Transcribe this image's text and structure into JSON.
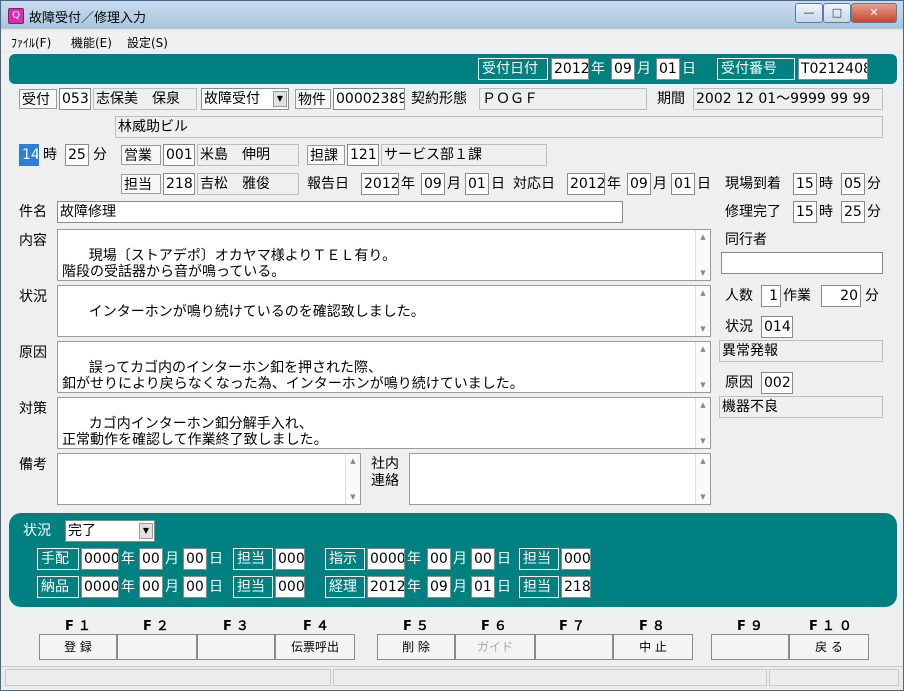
{
  "window": {
    "title": "故障受付／修理入力",
    "app_icon": "Q",
    "minimize": "—",
    "maximize": "□",
    "close": "✕"
  },
  "menu": [
    "ﾌｧｲﾙ(F)",
    "機能(E)",
    "設定(S)"
  ],
  "header": {
    "date_label": "受付日付",
    "year": "2012",
    "year_unit": "年",
    "month": "09",
    "month_unit": "月",
    "day": "01",
    "day_unit": "日",
    "number_label": "受付番号",
    "number": "T0212408"
  },
  "reception": {
    "label": "受付",
    "code": "053",
    "name": "志保美　保泉",
    "type": "故障受付",
    "property_label": "物件",
    "property_code": "00002389",
    "contract_label": "契約形態",
    "contract": "ＰＯＧＦ",
    "period_label": "期間",
    "period": "2002 12 01～9999 99 99",
    "building": "林威助ビル"
  },
  "time": {
    "hour": "14",
    "hour_unit": "時",
    "minute": "25",
    "minute_unit": "分"
  },
  "sales": {
    "label": "営業",
    "code": "001",
    "name": "米島　伸明",
    "dept_label": "担課",
    "dept_code": "121",
    "dept_name": "サービス部１課"
  },
  "staff": {
    "label": "担当",
    "code": "218",
    "name": "吉松　雅俊",
    "report_label": "報告日",
    "report_year": "2012",
    "report_month": "09",
    "report_day": "01",
    "response_label": "対応日",
    "response_year": "2012",
    "response_month": "09",
    "response_day": "01",
    "arrival_label": "現場到着",
    "arrival_hour": "15",
    "arrival_minute": "05"
  },
  "units": {
    "year": "年",
    "month": "月",
    "day": "日",
    "hour": "時",
    "minute": "分"
  },
  "subject": {
    "label": "件名",
    "value": "故障修理",
    "repair_done_label": "修理完了",
    "repair_hour": "15",
    "repair_minute": "25"
  },
  "details": {
    "content_label": "内容",
    "content": "現場〔ストアデポ〕オカヤマ様よりＴＥＬ有り。\n階段の受話器から音が鳴っている。",
    "status_label": "状況",
    "status": "インターホンが鳴り続けているのを確認致しました。",
    "cause_label": "原因",
    "cause": "誤ってカゴ内のインターホン釦を押された際、\n釦がせりにより戻らなくなった為、インターホンが鳴り続けていました。",
    "measure_label": "対策",
    "measure": "カゴ内インターホン釦分解手入れ、\n正常動作を確認して作業終了致しました。",
    "remarks_label": "備考",
    "remarks": "",
    "internal_label": "社内\n連絡",
    "internal": ""
  },
  "side": {
    "companion_label": "同行者",
    "companion": "",
    "people_label": "人数",
    "people": "1",
    "work_label": "作業",
    "work_minutes": "20",
    "minute_unit": "分",
    "status_label": "状況",
    "status_code": "014",
    "status_name": "異常発報",
    "cause_label": "原因",
    "cause_code": "002",
    "cause_name": "機器不良"
  },
  "status_panel": {
    "label": "状況",
    "value": "完了",
    "arrange_label": "手配",
    "arrange_year": "0000",
    "arrange_month": "00",
    "arrange_day": "00",
    "arrange_staff_label": "担当",
    "arrange_staff": "000",
    "instruct_label": "指示",
    "instruct_year": "0000",
    "instruct_month": "00",
    "instruct_day": "00",
    "instruct_staff_label": "担当",
    "instruct_staff": "000",
    "delivery_label": "納品",
    "delivery_year": "0000",
    "delivery_month": "00",
    "delivery_day": "00",
    "delivery_staff_label": "担当",
    "delivery_staff": "000",
    "accounting_label": "経理",
    "accounting_year": "2012",
    "accounting_month": "09",
    "accounting_day": "01",
    "accounting_staff_label": "担当",
    "accounting_staff": "218"
  },
  "fkeys": [
    {
      "key": "F１",
      "label": "登 録",
      "enabled": true
    },
    {
      "key": "F２",
      "label": "",
      "enabled": true
    },
    {
      "key": "F３",
      "label": "",
      "enabled": true
    },
    {
      "key": "F４",
      "label": "伝票呼出",
      "enabled": true
    },
    {
      "key": "F５",
      "label": "削 除",
      "enabled": true
    },
    {
      "key": "F６",
      "label": "ガイド",
      "enabled": false
    },
    {
      "key": "F７",
      "label": "",
      "enabled": true
    },
    {
      "key": "F８",
      "label": "中 止",
      "enabled": true
    },
    {
      "key": "F９",
      "label": "",
      "enabled": true
    },
    {
      "key": "F１０",
      "label": "戻 る",
      "enabled": true
    }
  ],
  "colors": {
    "teal": "#008080",
    "selection": "#2a7fd8",
    "app_icon": "#d62fb0"
  }
}
